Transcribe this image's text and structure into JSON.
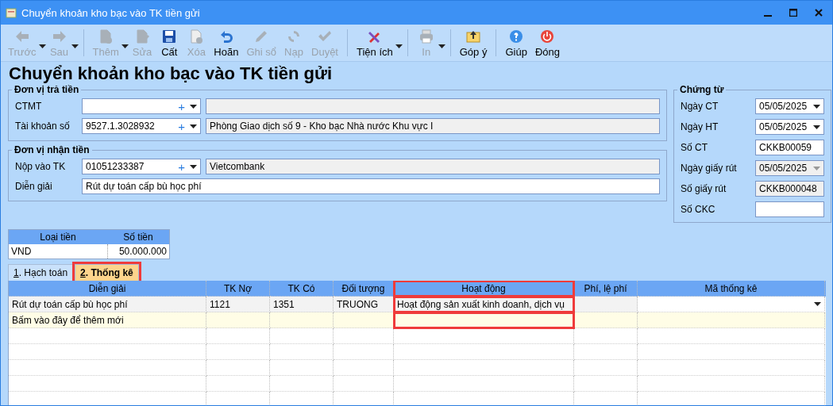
{
  "window": {
    "title": "Chuyển khoản kho bạc vào TK tiền gửi"
  },
  "toolbar": [
    [
      {
        "label": "Trước",
        "disabled": true,
        "has_menu": true
      },
      {
        "label": "Sau",
        "disabled": true,
        "has_menu": true
      }
    ],
    [
      {
        "label": "Thêm",
        "disabled": true,
        "has_menu": true
      },
      {
        "label": "Sửa",
        "disabled": true,
        "has_menu": false
      },
      {
        "label": "Cất",
        "disabled": false,
        "has_menu": false
      },
      {
        "label": "Xóa",
        "disabled": true,
        "has_menu": false
      },
      {
        "label": "Hoãn",
        "disabled": false,
        "has_menu": false
      },
      {
        "label": "Ghi sổ",
        "disabled": true,
        "has_menu": false
      },
      {
        "label": "Nạp",
        "disabled": true,
        "has_menu": false
      },
      {
        "label": "Duyệt",
        "disabled": true,
        "has_menu": false
      }
    ],
    [
      {
        "label": "Tiện ích",
        "disabled": false,
        "has_menu": true
      }
    ],
    [
      {
        "label": "In",
        "disabled": true,
        "has_menu": true
      }
    ],
    [
      {
        "label": "Góp ý",
        "disabled": false,
        "has_menu": false
      }
    ],
    [
      {
        "label": "Giúp",
        "disabled": false,
        "has_menu": false
      },
      {
        "label": "Đóng",
        "disabled": false,
        "has_menu": false
      }
    ]
  ],
  "heading": "Chuyển khoản kho bạc vào TK tiền gửi",
  "groups": [
    {
      "legend": "Đơn vị trả tiền",
      "fields": [
        {
          "kind": "combo",
          "label": "CTMT",
          "add": "+"
        },
        {
          "kind": "combo",
          "label": "Tài khoản số",
          "value": "9527.1.3028932",
          "add": "+",
          "description": "Phòng Giao dịch số 9 - Kho bạc Nhà nước Khu vực I"
        }
      ]
    },
    {
      "legend": "Đơn vị nhận tiền",
      "fields": [
        {
          "kind": "combo",
          "label": "Nộp vào TK",
          "value": "01051233387",
          "add": "+",
          "description": "Vietcombank"
        },
        {
          "kind": "text",
          "label": "Diễn giải",
          "value": "Rút dự toán cấp bù học phí"
        }
      ]
    }
  ],
  "voucher": {
    "legend": "Chứng từ",
    "fields": [
      {
        "kind": "date",
        "label": "Ngày CT",
        "value": "05/05/2025",
        "disabled": false
      },
      {
        "kind": "date",
        "label": "Ngày HT",
        "value": "05/05/2025",
        "disabled": false
      },
      {
        "kind": "text",
        "label": "Số CT",
        "value": "CKKB00059",
        "disabled": false
      },
      {
        "kind": "date",
        "label": "Ngày giấy rút",
        "value": "05/05/2025",
        "disabled": true
      },
      {
        "kind": "text",
        "label": "Số giấy rút",
        "value": "CKKB000048",
        "disabled": true
      },
      {
        "kind": "text",
        "label": "Số CKC",
        "disabled": false
      }
    ]
  },
  "amounts": {
    "columns": [
      "Loại tiền",
      "Số tiền"
    ],
    "rows": [
      [
        "VND",
        "50.000.000"
      ]
    ]
  },
  "tabs": [
    {
      "key": "1",
      "label": ". Hạch toán",
      "selected": false,
      "highlighted": false
    },
    {
      "key": "2",
      "label": ". Thống kê",
      "selected": true,
      "highlighted": true
    }
  ],
  "table": {
    "columns": [
      {
        "label": "Diễn giải",
        "highlighted": false
      },
      {
        "label": "TK Nợ",
        "highlighted": false
      },
      {
        "label": "TK Có",
        "highlighted": false
      },
      {
        "label": "Đối tượng",
        "highlighted": false
      },
      {
        "label": "Hoạt động",
        "highlighted": true
      },
      {
        "label": "Phí, lệ phí",
        "highlighted": false
      },
      {
        "label": "Mã thống kê",
        "highlighted": false
      }
    ],
    "rows": [
      {
        "kind": "entry",
        "cells": [
          "Rút dự toán cấp bù học phí",
          "1121",
          "1351",
          "TRUONG",
          "Hoạt động sản xuất kinh doanh, dịch vụ",
          "",
          ""
        ],
        "has_dropdown": true
      },
      {
        "kind": "new",
        "text": "Bấm vào đây để thêm mới"
      }
    ]
  }
}
